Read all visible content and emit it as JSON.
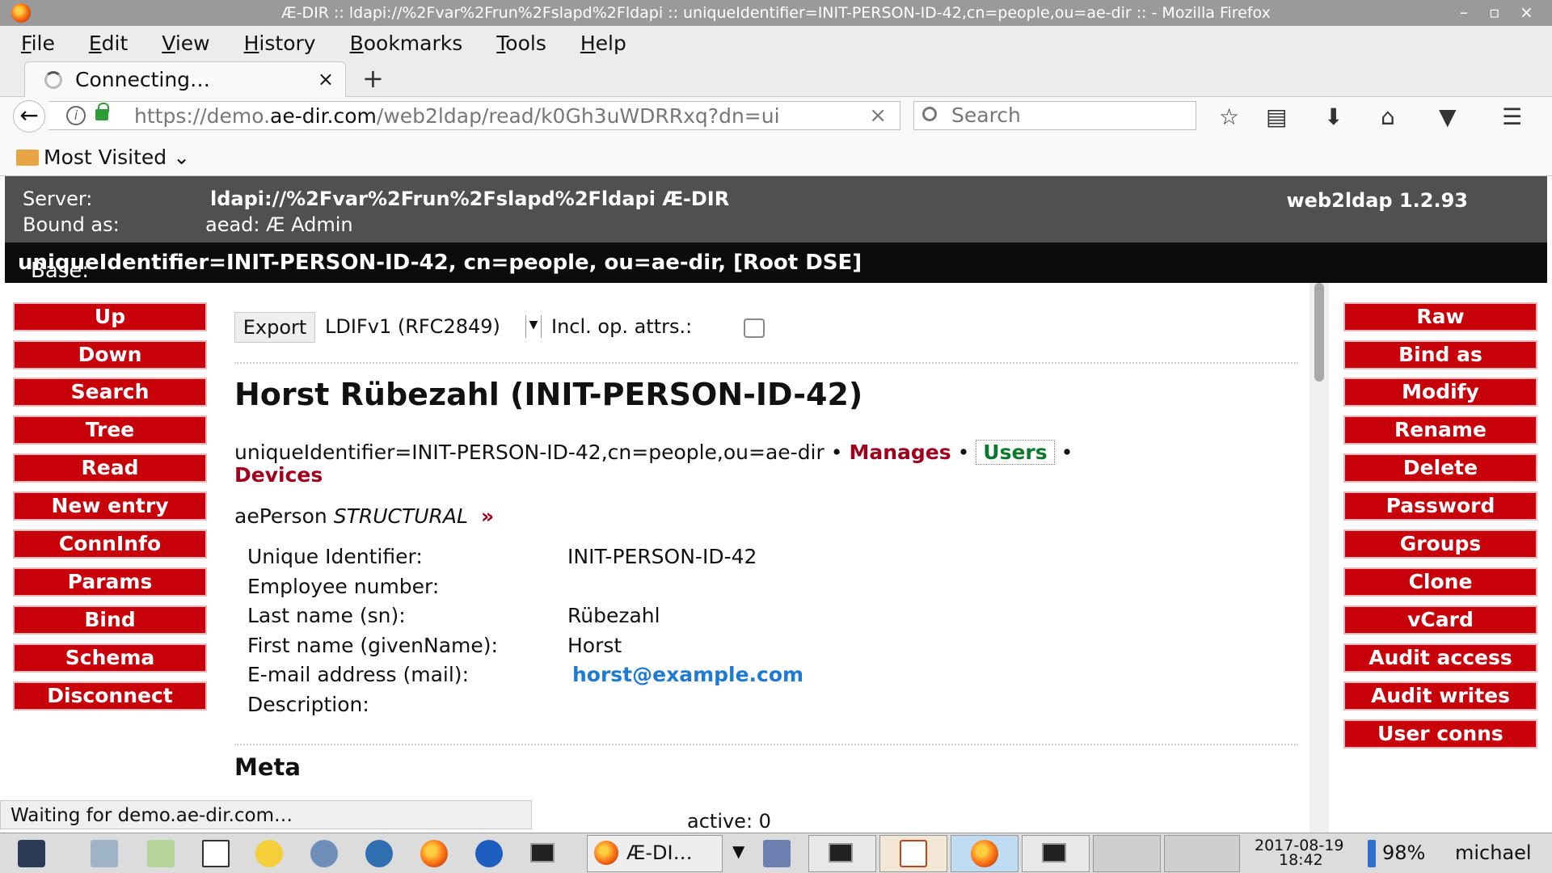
{
  "window": {
    "title": "Æ-DIR :: ldapi://%2Fvar%2Frun%2Fslapd%2Fldapi :: uniqueIdentifier=INIT-PERSON-ID-42,cn=people,ou=ae-dir :: - Mozilla Firefox",
    "controls": [
      "–",
      "▫",
      "×"
    ]
  },
  "menu": [
    "File",
    "Edit",
    "View",
    "History",
    "Bookmarks",
    "Tools",
    "Help"
  ],
  "tab": {
    "label": "Connecting…",
    "close": "×",
    "new": "+"
  },
  "nav": {
    "url_prefix": "https://demo.",
    "url_domain": "ae-dir.com",
    "url_rest": "/web2ldap/read/k0Gh3uWDRRxq?dn=ui",
    "url_clear": "×",
    "search_placeholder": "Search"
  },
  "bookmarks": {
    "folder_label": "Most Visited"
  },
  "header": {
    "server_label": "Server:",
    "server_value": "ldapi://%2Fvar%2Frun%2Fslapd%2Fldapi  Æ-DIR",
    "bound_label": "Bound as:",
    "bound_value": "aead: Æ Admin",
    "version": "web2ldap 1.2.93",
    "base_label": "Base:",
    "base_value": "uniqueIdentifier=INIT-PERSON-ID-42, cn=people, ou=ae-dir, [Root DSE]"
  },
  "left_buttons": [
    "Up",
    "Down",
    "Search",
    "Tree",
    "Read",
    "New entry",
    "ConnInfo",
    "Params",
    "Bind",
    "Schema",
    "Disconnect"
  ],
  "right_buttons": [
    "Raw",
    "Bind as",
    "Modify",
    "Rename",
    "Delete",
    "Password",
    "Groups",
    "Clone",
    "vCard",
    "Audit access",
    "Audit writes",
    "User conns"
  ],
  "export": {
    "button": "Export",
    "format": "LDIFv1 (RFC2849)",
    "incl_label": "Incl. op. attrs.:",
    "incl_checked": false
  },
  "entry": {
    "title": "Horst Rübezahl (INIT-PERSON-ID-42)",
    "dn": "uniqueIdentifier=INIT-PERSON-ID-42,cn=people,ou=ae-dir",
    "links": {
      "manages": "Manages",
      "users": "Users",
      "devices": "Devices"
    },
    "sep": "•",
    "objectclass": "aePerson",
    "oc_kind": "STRUCTURAL",
    "oc_more": "»",
    "attributes": [
      {
        "name": "Unique Identifier:",
        "value": "INIT-PERSON-ID-42"
      },
      {
        "name": "Employee number:",
        "value": ""
      },
      {
        "name": "Last name (sn):",
        "value": "Rübezahl"
      },
      {
        "name": "First name (givenName):",
        "value": "Horst"
      },
      {
        "name": "E-mail address (mail):",
        "value": "horst@example.com"
      },
      {
        "name": "Description:",
        "value": ""
      }
    ],
    "meta_heading": "Meta"
  },
  "status": {
    "text": "Waiting for demo.ae-dir.com…",
    "active": "active: 0"
  },
  "taskbar": {
    "task_label": "Æ-DI…",
    "date": "2017-08-19",
    "time": "18:42",
    "battery": "98%",
    "user": "michael"
  },
  "colors": {
    "button_red": "#c8000a",
    "header_gray": "#505050",
    "link_red": "#a0001e",
    "link_green": "#0b7a2e",
    "mail_blue": "#1f7bd1"
  }
}
